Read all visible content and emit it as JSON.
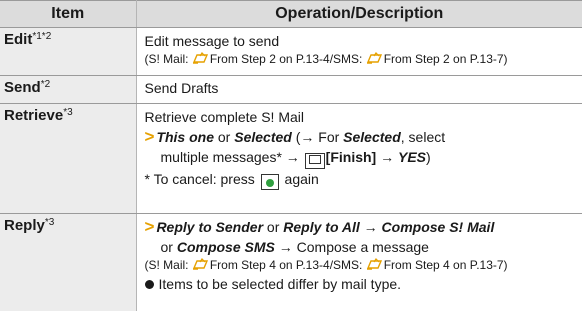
{
  "header": {
    "col1": "Item",
    "col2": "Operation/Description"
  },
  "rows": [
    {
      "item": "Edit",
      "sup": "*1*2",
      "line1": "Edit message to send",
      "line2_pre": "(S! Mail: ",
      "line2_mid": "From Step 2 on P.13-4/SMS: ",
      "line2_post": "From Step 2 on P.13-7)"
    },
    {
      "item": "Send",
      "sup": "*2",
      "line1": "Send Drafts"
    },
    {
      "item": "Retrieve",
      "sup": "*3",
      "line1": "Retrieve complete S! Mail",
      "l2_this": "This one",
      "l2_or": " or ",
      "l2_selected": "Selected",
      "l2_paren": " (→ For ",
      "l2_selected2": "Selected",
      "l2_select": ", select",
      "l3_multi": "multiple messages* → ",
      "l3_finish": "[Finish]",
      "l3_arrow": " → ",
      "l3_yes": "YES",
      "l3_close": ")",
      "l4_pre": "* To cancel: press ",
      "l4_post": " again"
    },
    {
      "item": "Reply",
      "sup": "*3",
      "l1_sender": "Reply to Sender",
      "l1_or": " or ",
      "l1_all": "Reply to All",
      "l1_arrow": " → ",
      "l1_compose": "Compose S! Mail",
      "l2_or": "or ",
      "l2_sms": "Compose SMS",
      "l2_arrow": " → ",
      "l2_msg": "Compose a message",
      "l3_pre": "(S! Mail: ",
      "l3_mid": "From Step 4 on P.13-4/SMS: ",
      "l3_post": "From Step 4 on P.13-7)",
      "l4": "Items to be selected differ by mail type."
    }
  ],
  "colors": {
    "arrow": "#e6a100",
    "center_key": "#2f9e3e",
    "header_bg": "#dcdcdc",
    "item_bg": "#ececec"
  }
}
